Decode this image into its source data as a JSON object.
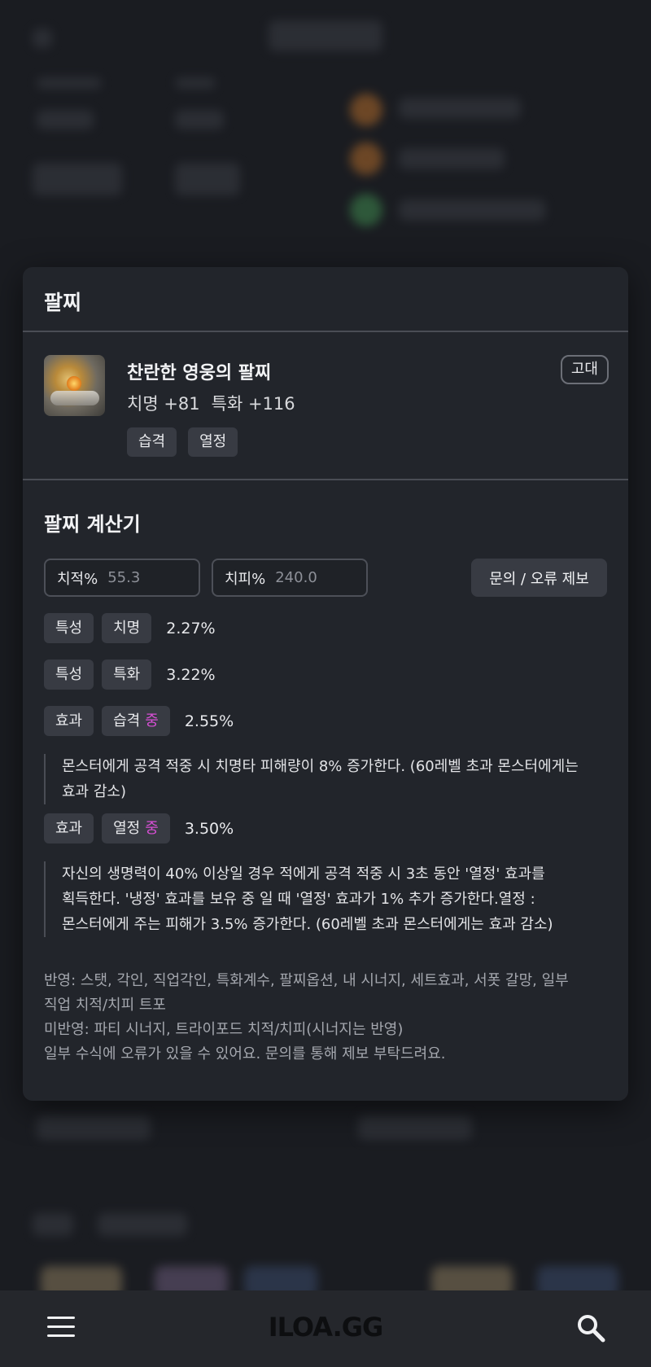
{
  "modal": {
    "title": "팔찌",
    "item": {
      "name": "찬란한 영웅의 팔찌",
      "stat1": "치명 +81",
      "stat2": "특화 +116",
      "tags": [
        "습격",
        "열정"
      ],
      "grade": "고대"
    },
    "calculator": {
      "title": "팔찌 계산기",
      "crit_rate": {
        "label": "치적%",
        "value": "55.3"
      },
      "crit_dmg": {
        "label": "치피%",
        "value": "240.0"
      },
      "report_button": "문의 / 오류 제보",
      "rows": [
        {
          "type": "특성",
          "name": "치명",
          "tier": "",
          "pct": "2.27%"
        },
        {
          "type": "특성",
          "name": "특화",
          "tier": "",
          "pct": "3.22%"
        },
        {
          "type": "효과",
          "name": "습격",
          "tier": "중",
          "pct": "2.55%"
        },
        {
          "type": "효과",
          "name": "열정",
          "tier": "중",
          "pct": "3.50%"
        }
      ],
      "desc_1_line1": "몬스터에게 공격 적중 시 치명타 피해량이 8% 증가한다. (60레벨 초과 몬스터에게는",
      "desc_1_line2": "효과 감소)",
      "desc_2_line1": "자신의 생명력이 40% 이상일 경우 적에게 공격 적중 시 3초 동안 '열정' 효과를",
      "desc_2_line2": "획득한다. '냉정' 효과를 보유 중 일 때 '열정' 효과가 1% 추가 증가한다.열정 :",
      "desc_2_line3": "몬스터에게 주는 피해가 3.5% 증가한다. (60레벨 초과 몬스터에게는 효과 감소)",
      "note_line1": "반영: 스탯, 각인, 직업각인, 특화계수, 팔찌옵션, 내 시너지, 세트효과, 서폿 갈망, 일부",
      "note_line2": "직업 치적/치피 트포",
      "note_line3": "미반영: 파티 시너지, 트라이포드 치적/치피(시너지는 반영)",
      "note_line4": "일부 수식에 오류가 있을 수 있어요. 문의를 통해 제보 부탁드려요."
    }
  },
  "bottom_bar": {
    "logo": "ILOA.GG",
    "menu_icon": "hamburger-menu-icon",
    "search_icon": "search-icon"
  },
  "colors": {
    "background": "#1a1c21",
    "panel": "#22252b",
    "chip": "#383b43",
    "tier_accent": "#d94fd6"
  }
}
